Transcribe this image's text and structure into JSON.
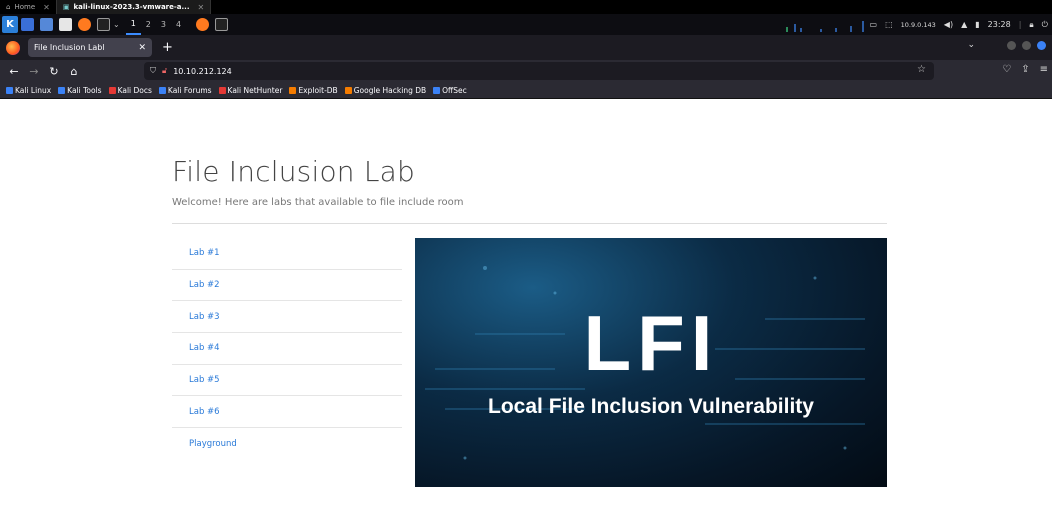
{
  "vm": {
    "tabs": [
      {
        "label": "Home"
      },
      {
        "label": "kali-linux-2023.3-vmware-a..."
      }
    ]
  },
  "panel": {
    "workspaces": [
      "1",
      "2",
      "3",
      "4"
    ],
    "ip": "10.9.0.143",
    "clock": "23:28"
  },
  "browser": {
    "tab_title": "File Inclusion Labl",
    "url": "10.10.212.124",
    "bookmarks": [
      {
        "label": "Kali Linux",
        "color": "#3b82f6"
      },
      {
        "label": "Kali Tools",
        "color": "#3b82f6"
      },
      {
        "label": "Kali Docs",
        "color": "#e53935"
      },
      {
        "label": "Kali Forums",
        "color": "#3b82f6"
      },
      {
        "label": "Kali NetHunter",
        "color": "#e53935"
      },
      {
        "label": "Exploit-DB",
        "color": "#f57c00"
      },
      {
        "label": "Google Hacking DB",
        "color": "#f57c00"
      },
      {
        "label": "OffSec",
        "color": "#3b82f6"
      }
    ]
  },
  "page": {
    "title": "File Inclusion Lab",
    "subtitle": "Welcome! Here are labs that available to file include room",
    "labs": [
      "Lab #1",
      "Lab #2",
      "Lab #3",
      "Lab #4",
      "Lab #5",
      "Lab #6",
      "Playground"
    ],
    "banner": {
      "headline": "LFI",
      "subline": "Local File Inclusion Vulnerability"
    }
  }
}
